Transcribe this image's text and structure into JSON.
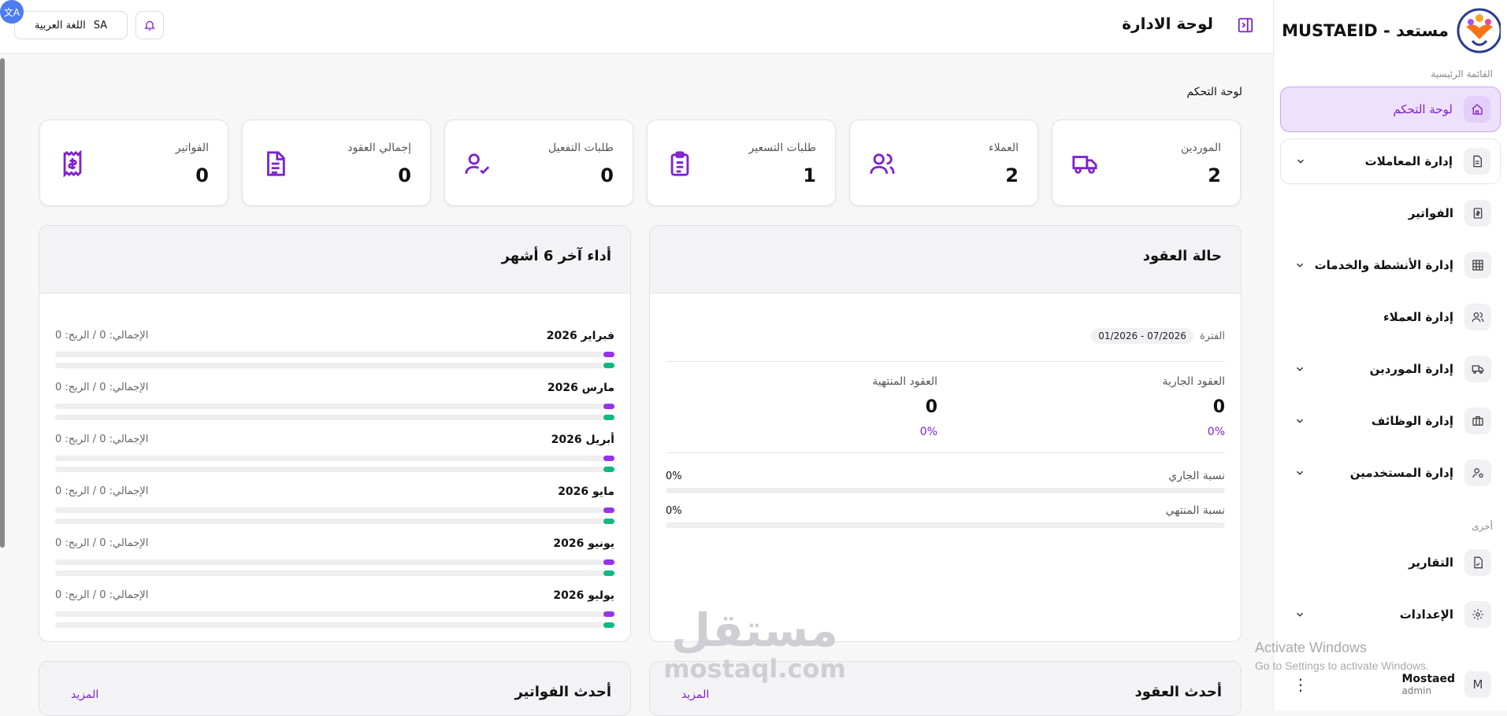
{
  "sidebar": {
    "brand": "مستعد - MUSTAEID",
    "main_label": "القائمة الرئيسية",
    "other_label": "أخرى",
    "items": [
      {
        "label": "لوحة التحكم",
        "icon": "home-icon"
      },
      {
        "label": "إدارة المعاملات",
        "icon": "document-icon"
      },
      {
        "label": "الفواتير",
        "icon": "invoice-icon"
      },
      {
        "label": "إدارة الأنشطة والخدمات",
        "icon": "grid-icon"
      },
      {
        "label": "إدارة العملاء",
        "icon": "users-icon"
      },
      {
        "label": "إدارة الموردين",
        "icon": "truck-icon"
      },
      {
        "label": "إدارة الوظائف",
        "icon": "briefcase-icon"
      },
      {
        "label": "إدارة المستخدمين",
        "icon": "user-settings-icon"
      }
    ],
    "other_items": [
      {
        "label": "التقارير",
        "icon": "report-icon"
      },
      {
        "label": "الإعدادات",
        "icon": "gear-icon"
      }
    ],
    "user": {
      "name": "Mostaed",
      "role": "admin",
      "initial": "M"
    }
  },
  "header": {
    "title": "لوحة الادارة",
    "language_label": "اللغة العربية",
    "language_code": "SA",
    "translate_badge": "文A"
  },
  "breadcrumb": "لوحة التحكم",
  "stats": [
    {
      "label": "الموردين",
      "value": "2",
      "icon": "truck-icon"
    },
    {
      "label": "العملاء",
      "value": "2",
      "icon": "users-icon"
    },
    {
      "label": "طلبات التسعير",
      "value": "1",
      "icon": "clipboard-list-icon"
    },
    {
      "label": "طلبات التفعيل",
      "value": "0",
      "icon": "user-check-icon"
    },
    {
      "label": "إجمالي العقود",
      "value": "0",
      "icon": "file-text-icon"
    },
    {
      "label": "الفواتير",
      "value": "0",
      "icon": "receipt-icon"
    }
  ],
  "contracts_status": {
    "title": "حالة العقود",
    "period_label": "الفترة",
    "period_value": "01/2026 - 07/2026",
    "current_label": "العقود الجارية",
    "current_value": "0",
    "current_pct": "0%",
    "ended_label": "العقود المنتهية",
    "ended_value": "0",
    "ended_pct": "0%",
    "current_ratio_label": "نسبة الجاري",
    "current_ratio_value": "0%",
    "ended_ratio_label": "نسبة المنتهي",
    "ended_ratio_value": "0%"
  },
  "performance": {
    "title": "أداء آخر 6 أشهر",
    "months": [
      {
        "name": "فبراير 2026",
        "meta": "الإجمالي: 0 / الربح: 0"
      },
      {
        "name": "مارس 2026",
        "meta": "الإجمالي: 0 / الربح: 0"
      },
      {
        "name": "أبريل 2026",
        "meta": "الإجمالي: 0 / الربح: 0"
      },
      {
        "name": "مايو 2026",
        "meta": "الإجمالي: 0 / الربح: 0"
      },
      {
        "name": "يونيو 2026",
        "meta": "الإجمالي: 0 / الربح: 0"
      },
      {
        "name": "يوليو 2026",
        "meta": "الإجمالي: 0 / الربح: 0"
      }
    ]
  },
  "latest_contracts": {
    "title": "أحدث العقود",
    "more": "المزيد"
  },
  "latest_invoices": {
    "title": "أحدث الفواتير",
    "more": "المزيد"
  },
  "watermark": {
    "ar": "مستقل",
    "en": "mostaql.com"
  },
  "activation": {
    "line1": "Activate Windows",
    "line2": "Go to Settings to activate Windows."
  },
  "colors": {
    "accent": "#7e22ce",
    "accent_light": "#ede1fb",
    "bar_purple": "#9333ea",
    "bar_green": "#10b981"
  }
}
